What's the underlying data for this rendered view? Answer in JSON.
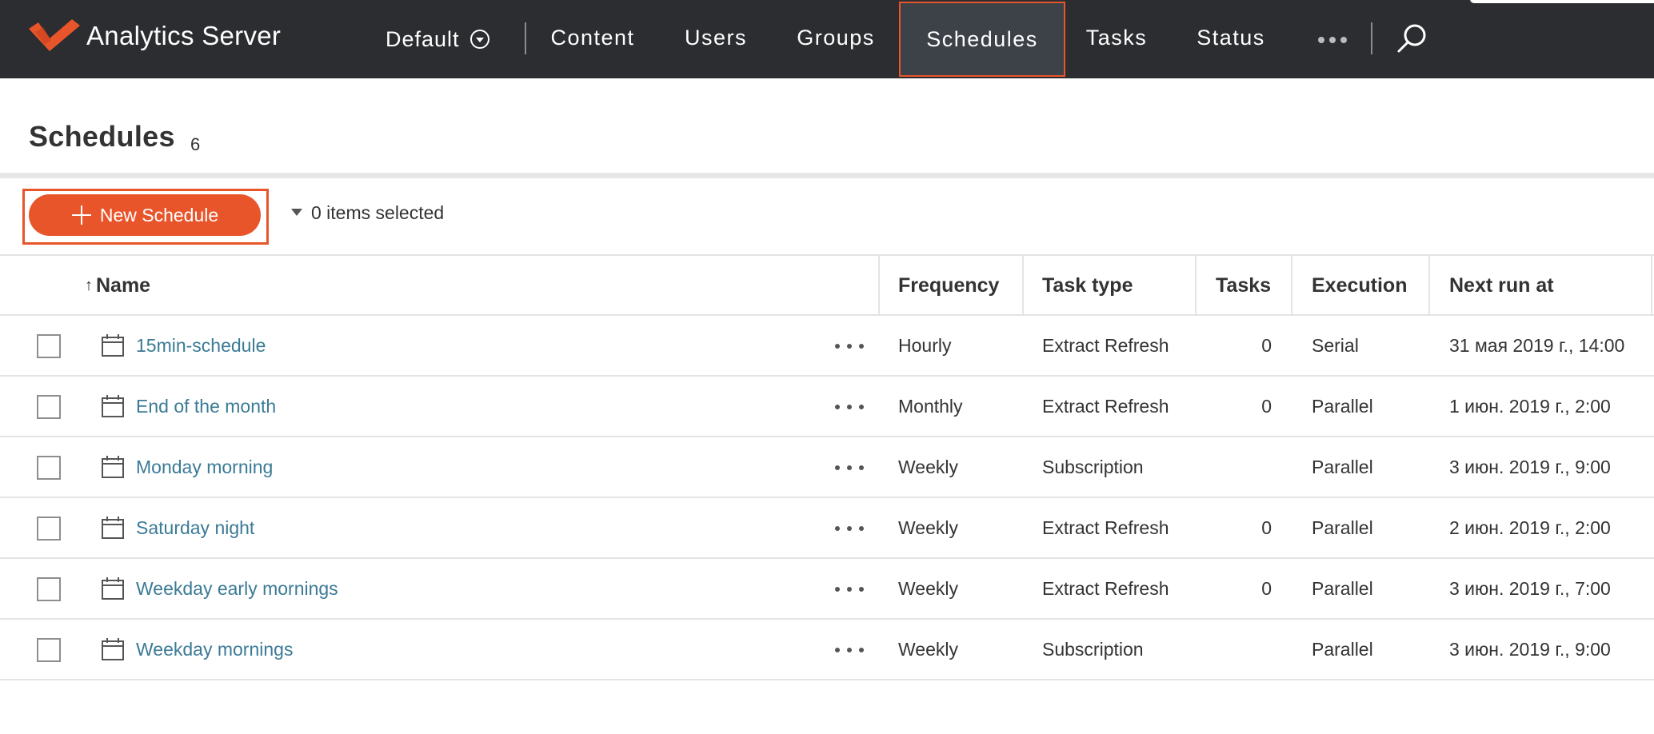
{
  "app": {
    "brand_name": "Analytics Server",
    "accent_color": "#e8552b",
    "nav_bg": "#2b2d30",
    "link_color": "#3b7a96"
  },
  "nav": {
    "site_select": "Default",
    "items": [
      {
        "label": "Content"
      },
      {
        "label": "Users"
      },
      {
        "label": "Groups"
      },
      {
        "label": "Schedules",
        "active": true
      },
      {
        "label": "Tasks"
      },
      {
        "label": "Status"
      }
    ],
    "more_icon": "ellipsis-icon",
    "search_icon": "search-icon"
  },
  "page": {
    "title": "Schedules",
    "count": "6"
  },
  "toolbar": {
    "new_button_label": "New Schedule",
    "selection_text": "0 items selected"
  },
  "table": {
    "headers": {
      "name": "Name",
      "frequency": "Frequency",
      "task_type": "Task type",
      "tasks": "Tasks",
      "execution": "Execution",
      "next_run": "Next run at"
    },
    "sort": {
      "column": "Name",
      "direction": "ascending"
    },
    "rows": [
      {
        "name": "15min-schedule",
        "frequency": "Hourly",
        "task_type": "Extract Refresh",
        "tasks": "0",
        "execution": "Serial",
        "next_run": "31 мая 2019 г., 14:00"
      },
      {
        "name": "End of the month",
        "frequency": "Monthly",
        "task_type": "Extract Refresh",
        "tasks": "0",
        "execution": "Parallel",
        "next_run": "1 июн. 2019 г., 2:00"
      },
      {
        "name": "Monday morning",
        "frequency": "Weekly",
        "task_type": "Subscription",
        "tasks": "",
        "execution": "Parallel",
        "next_run": "3 июн. 2019 г., 9:00"
      },
      {
        "name": "Saturday night",
        "frequency": "Weekly",
        "task_type": "Extract Refresh",
        "tasks": "0",
        "execution": "Parallel",
        "next_run": "2 июн. 2019 г., 2:00"
      },
      {
        "name": "Weekday early mornings",
        "frequency": "Weekly",
        "task_type": "Extract Refresh",
        "tasks": "0",
        "execution": "Parallel",
        "next_run": "3 июн. 2019 г., 7:00"
      },
      {
        "name": "Weekday mornings",
        "frequency": "Weekly",
        "task_type": "Subscription",
        "tasks": "",
        "execution": "Parallel",
        "next_run": "3 июн. 2019 г., 9:00"
      }
    ]
  }
}
